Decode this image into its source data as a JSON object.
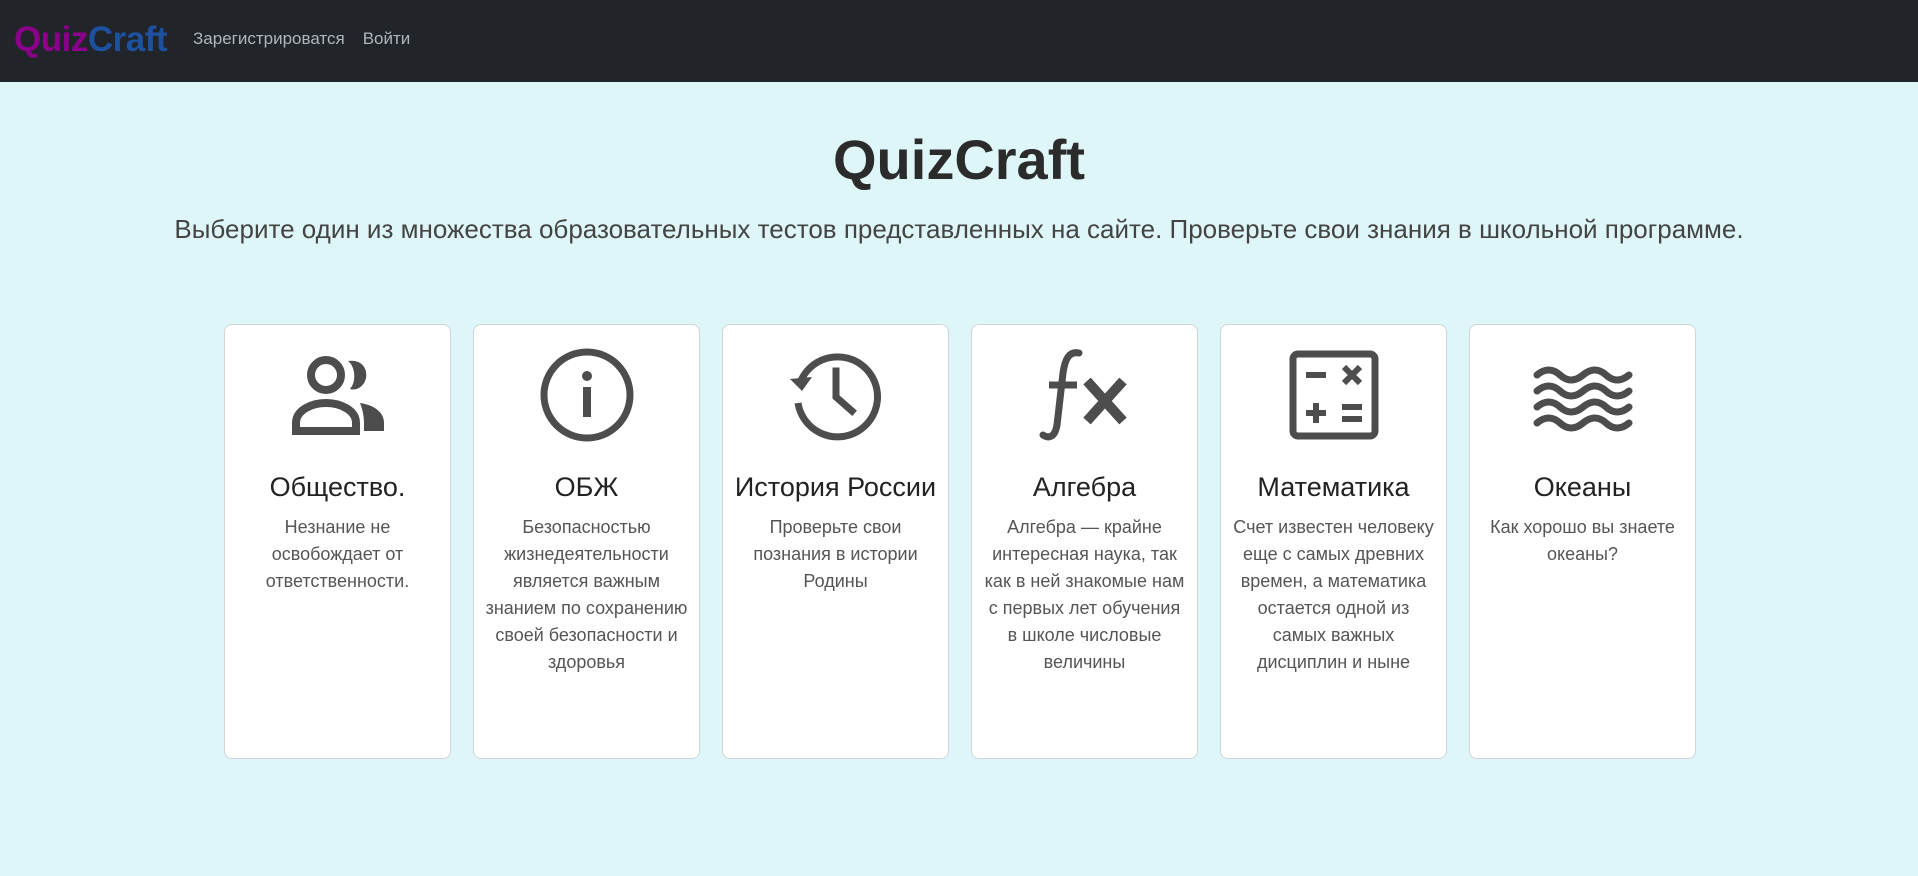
{
  "nav": {
    "brand_part1": "Quiz",
    "brand_part2": "Craft",
    "register": "Зарегистрироватся",
    "login": "Войти"
  },
  "hero": {
    "title": "QuizCraft",
    "subtitle": "Выберите один из множества образовательных тестов представленных на сайте. Проверьте свои знания в школьной программе."
  },
  "cards": [
    {
      "title": "Общество.",
      "desc": "Незнание не освобождает от ответственности.",
      "icon": "people-icon"
    },
    {
      "title": "ОБЖ",
      "desc": "Безопасностью жизнедеятельности является важным знанием по сохранению своей безопасности и здоровья",
      "icon": "info-icon"
    },
    {
      "title": "История России",
      "desc": "Проверьте свои познания в истории Родины",
      "icon": "history-icon"
    },
    {
      "title": "Алгебра",
      "desc": "Алгебра — крайне интересная наука, так как в ней знакомые нам с первых лет обучения в школе числовые величины",
      "icon": "function-icon"
    },
    {
      "title": "Математика",
      "desc": "Счет известен человеку еще с самых древних времен, а математика остается одной из самых важных дисциплин и ныне",
      "icon": "calculator-icon"
    },
    {
      "title": "Океаны",
      "desc": "Как хорошо вы знаете океаны?",
      "icon": "waves-icon"
    }
  ],
  "colors": {
    "navbar": "#212529",
    "background": "#dff6f8",
    "brand_purple": "#8b008b",
    "brand_blue": "#1e50a0",
    "icon": "#4d4d4d"
  }
}
